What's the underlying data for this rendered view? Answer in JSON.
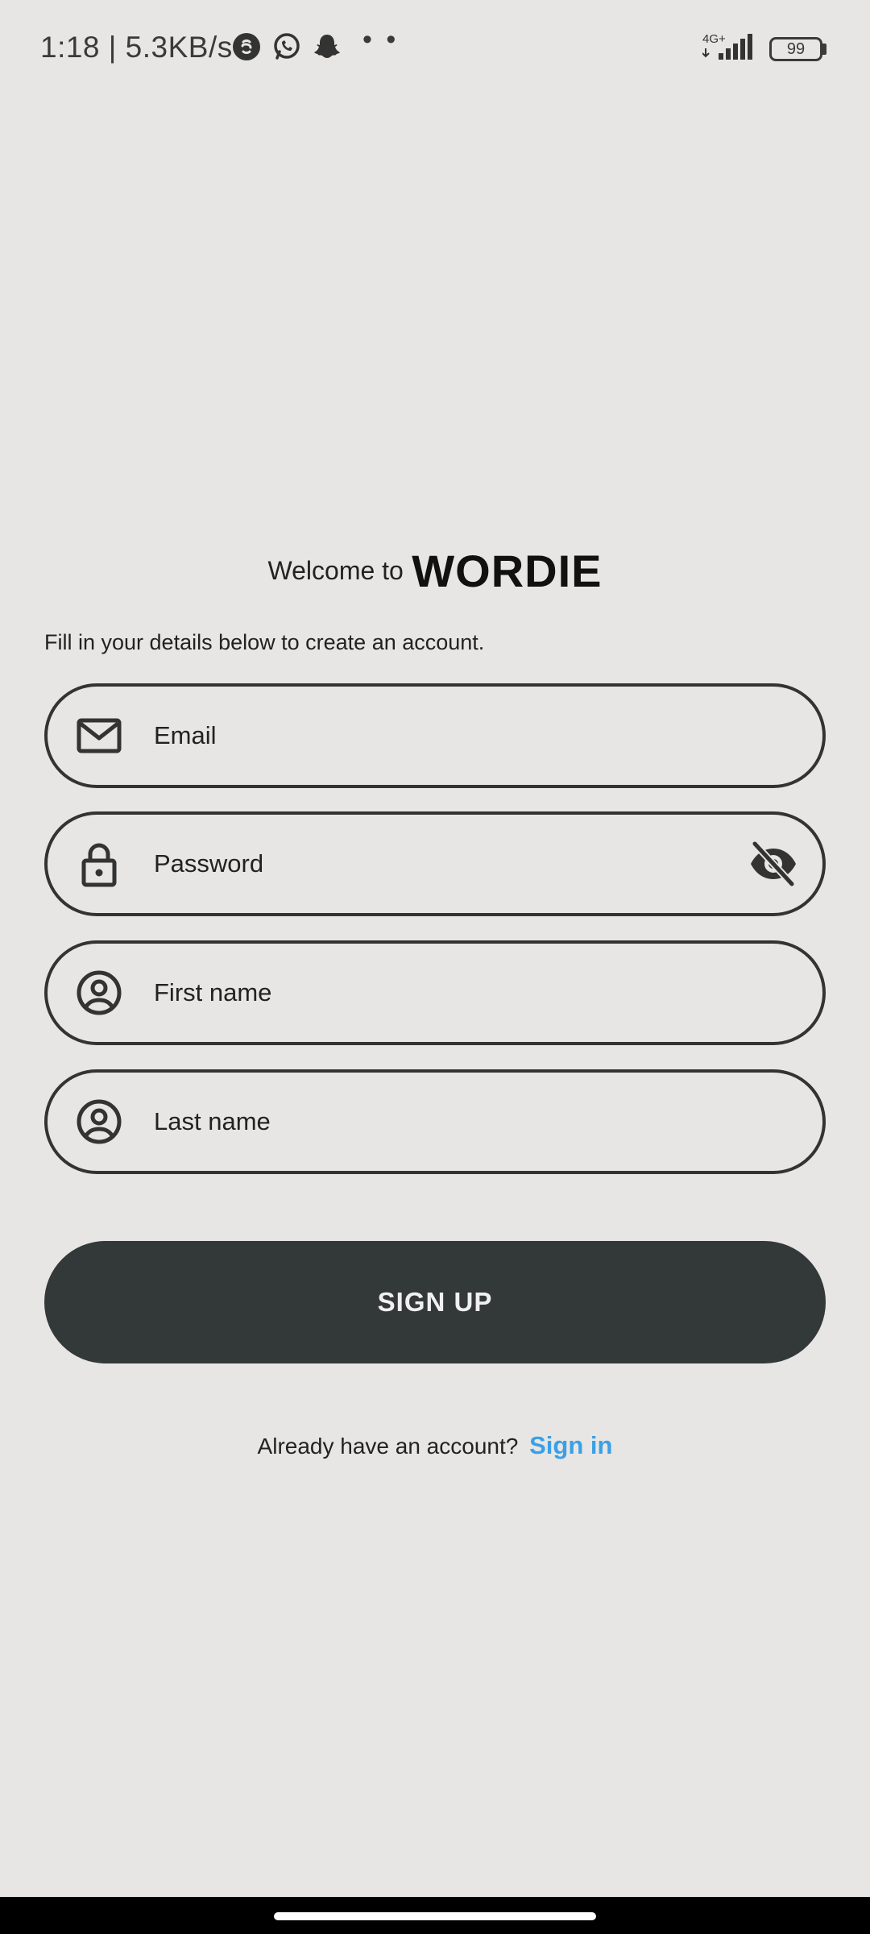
{
  "status_bar": {
    "time_speed": "1:18 | 5.3KB/s",
    "apps": [
      "shazam-icon",
      "whatsapp-icon",
      "snapchat-icon"
    ],
    "more": "• •",
    "network": "4G+",
    "battery": "99"
  },
  "header": {
    "welcome_prefix": "Welcome to",
    "brand": "WORDIE",
    "subtitle": "Fill in your details below to create an account."
  },
  "form": {
    "email_placeholder": "Email",
    "password_placeholder": "Password",
    "first_name_placeholder": "First name",
    "last_name_placeholder": "Last name",
    "submit_label": "SIGN UP"
  },
  "footer": {
    "prompt": "Already have an account?",
    "link": "Sign in"
  },
  "colors": {
    "background": "#e7e6e4",
    "button": "#333839",
    "link": "#3aa0e6"
  }
}
